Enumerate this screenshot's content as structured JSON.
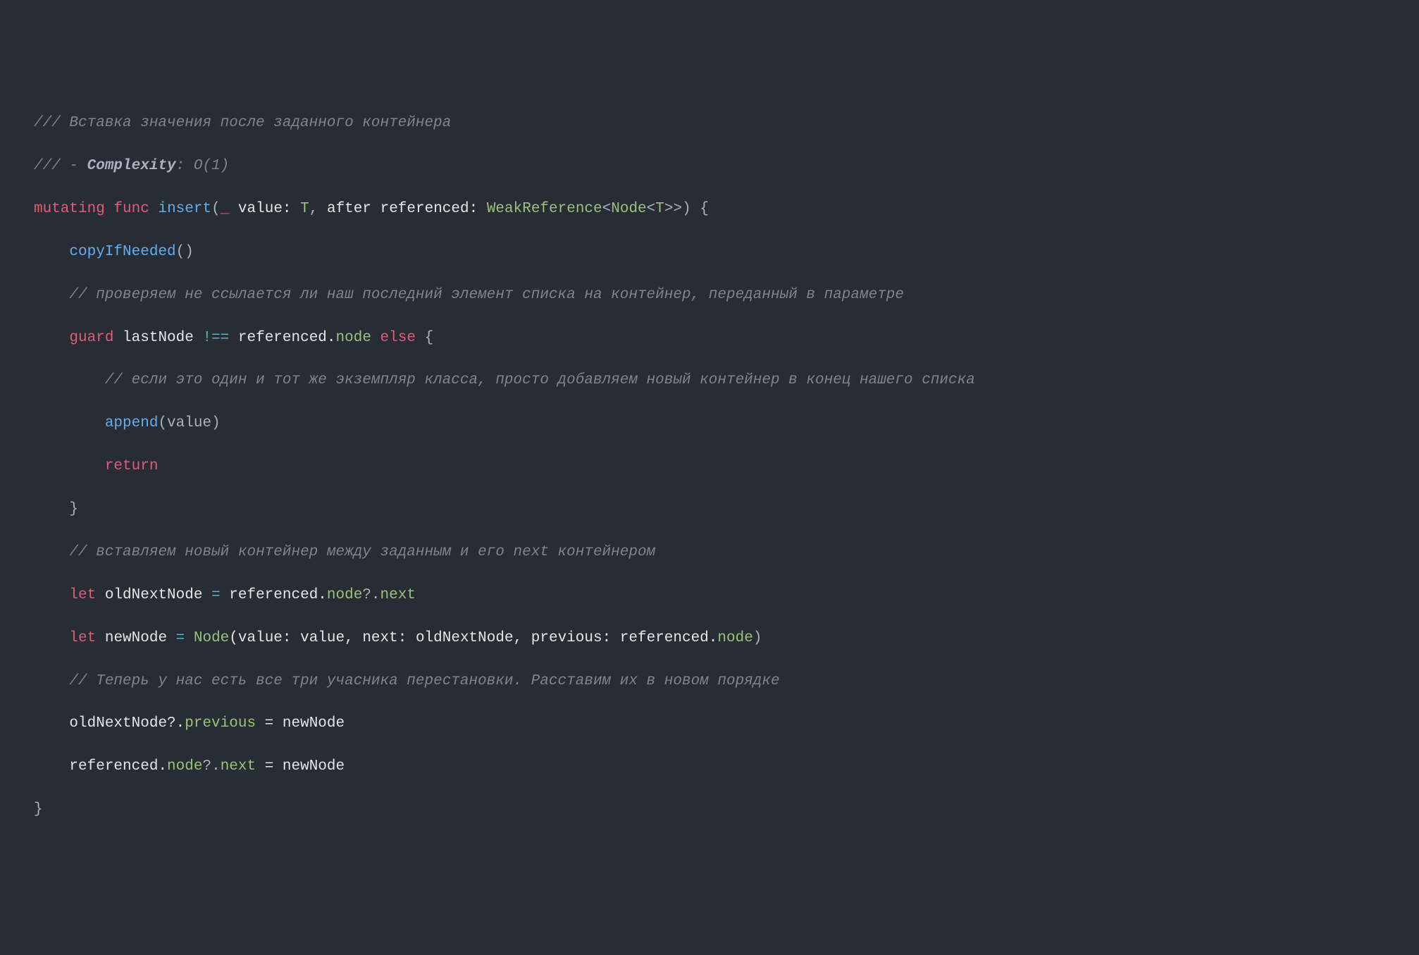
{
  "code": {
    "l1": {
      "doc": "/// Вставка значения после заданного контейнера"
    },
    "l2": {
      "docPrefix": "/// - ",
      "docBold": "Complexity",
      "docSuffix": ": O(1)"
    },
    "l3": {
      "kw1": "mutating",
      "kw2": "func",
      "fn": "insert",
      "p1": "(",
      "under": "_",
      "param1": " value: ",
      "type1": "T",
      "comma": ", ",
      "after": "after",
      "param2": " referenced: ",
      "type2a": "WeakReference",
      "lt1": "<",
      "type2b": "Node",
      "lt2": "<",
      "type2c": "T",
      "gt1": ">>",
      "p2": ") {"
    },
    "l4": {
      "fn": "copyIfNeeded",
      "p": "()"
    },
    "l5": {
      "c": "// проверяем не ссылается ли наш последний элемент списка на контейнер, переданный в параметре"
    },
    "l6": {
      "kw1": "guard",
      "id1": " lastNode ",
      "op": "!==",
      "id2": " referenced.",
      "prop": "node",
      "sp": " ",
      "kw2": "else",
      "br": " {"
    },
    "l7": {
      "c": "// если это один и тот же экземпляр класса, просто добавляем новый контейнер в конец нашего списка"
    },
    "l8": {
      "fn": "append",
      "p": "(value)"
    },
    "l9": {
      "kw": "return"
    },
    "l10": {
      "br": "}"
    },
    "l11": {
      "c": "// вставляем новый контейнер между заданным и его next контейнером"
    },
    "l12": {
      "kw": "let",
      "id1": " oldNextNode ",
      "eq": "=",
      "id2": " referenced.",
      "prop1": "node",
      "q": "?.",
      "prop2": "next"
    },
    "l13": {
      "kw": "let",
      "id1": " newNode ",
      "eq": "=",
      "sp": " ",
      "type": "Node",
      "p1": "(value: value, next: oldNextNode, previous: referenced.",
      "prop": "node",
      "p2": ")"
    },
    "l14": {
      "c": "// Теперь у нас есть все три учасника перестановки. Расставим их в новом порядке"
    },
    "l15": {
      "id1": "oldNextNode?.",
      "prop": "previous",
      "rest": " = newNode"
    },
    "l16": {
      "id1": "referenced.",
      "prop1": "node",
      "q": "?.",
      "prop2": "next",
      "rest": " = newNode"
    },
    "l17": {
      "br": "}"
    }
  }
}
